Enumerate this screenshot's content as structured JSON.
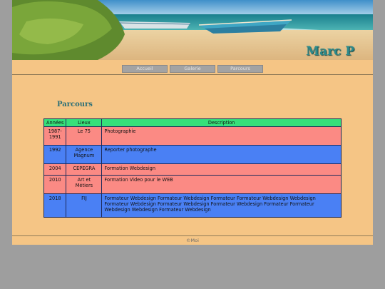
{
  "header": {
    "site_title": "Marc P"
  },
  "nav": {
    "items": [
      "Accueil",
      "Galerie",
      "Parcours"
    ]
  },
  "main": {
    "heading": "Parcours",
    "table": {
      "columns": [
        "Années",
        "Lieux",
        "Description"
      ],
      "rows": [
        {
          "annees": "1987-1991",
          "lieux": "Le 75",
          "description": "Photographie",
          "color": "#fb8a84"
        },
        {
          "annees": "1992",
          "lieux": "Agence Magnum",
          "description": "Reporter photographe",
          "color": "#4a80f4"
        },
        {
          "annees": "2004",
          "lieux": "CEPEGRA",
          "description": "Formation Webdesign",
          "color": "#fb8a84"
        },
        {
          "annees": "2010",
          "lieux": "Art et Métiers",
          "description": "Formation Video pour le WEB",
          "color": "#fb8a84"
        },
        {
          "annees": "2018",
          "lieux": "FIJ",
          "description": "Formateur Webdesign Formateur Webdesign Formateur Formateur Webdesign Webdesign Formateur Webdesign Formateur Webdesign Formateur Webdesign Formateur Formateur Webdesign Webdesign Formateur Webdesign",
          "color": "#4a80f4"
        }
      ]
    }
  },
  "footer": {
    "text": "©Moi"
  },
  "colors": {
    "page_bg": "#f5c585",
    "outer_bg": "#9e9e9e",
    "header_green": "#36e07a",
    "row_pink": "#fb8a84",
    "row_blue": "#4a80f4",
    "title_teal": "#2b8a8c"
  }
}
